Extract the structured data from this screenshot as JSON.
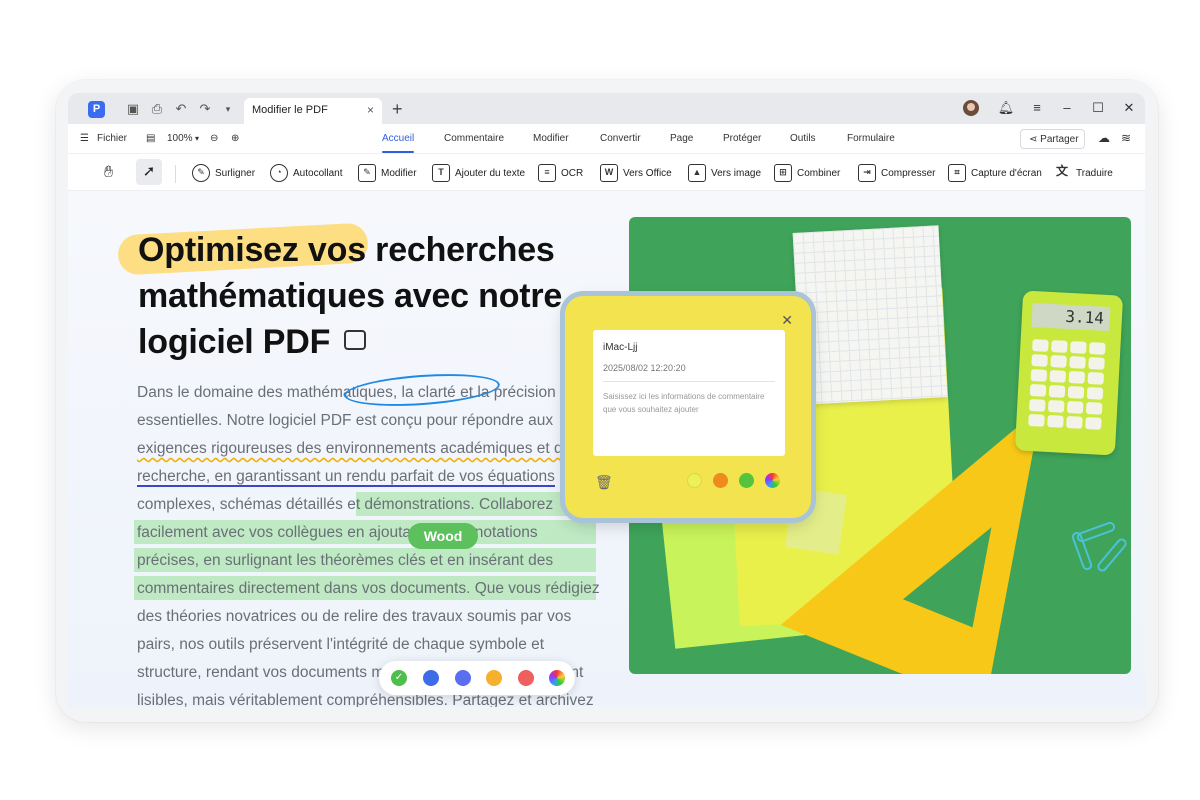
{
  "titlebar": {
    "tab_title": "Modifier le PDF",
    "tab_close_icon": "×",
    "new_tab_icon": "+"
  },
  "menubar": {
    "file_label": "Fichier",
    "zoom": "100%",
    "tabs": [
      "Accueil",
      "Commentaire",
      "Modifier",
      "Convertir",
      "Page",
      "Protéger",
      "Outils",
      "Formulaire"
    ],
    "active_tab": "Accueil",
    "share_label": "Partager"
  },
  "toolbar": {
    "tools": [
      "Surligner",
      "Autocollant",
      "Modifier",
      "Ajouter du texte",
      "OCR",
      "Vers Office",
      "Vers image",
      "Combiner",
      "Compresser",
      "Capture d'écran",
      "Traduire"
    ]
  },
  "document": {
    "headline_lines": [
      "Optimisez vos recherches",
      "mathématiques avec notre",
      "logiciel PDF"
    ],
    "body_lines": [
      "Dans le domaine des mathématiques, la clarté et la précision sont",
      "essentielles. Notre logiciel PDF est conçu pour répondre aux",
      "exigences rigoureuses des environnements académiques et de",
      "recherche, en garantissant un rendu parfait de vos équations",
      "complexes, schémas détaillés et démonstrations. Collaborez",
      "facilement avec vos collègues en ajoutant des annotations",
      "précises, en surlignant les théorèmes clés et en insérant des",
      "commentaires directement dans vos documents. Que vous rédigiez",
      "des théories novatrices ou de relire des travaux soumis par vos",
      "pairs, nos outils préservent l'intégrité de chaque symbole et",
      "structure, rendant vos documents mathématiques non seulement",
      "lisibles, mais véritablement compréhensibles. Partagez et archivez"
    ],
    "highlight_chip": "Wood"
  },
  "color_picker": {
    "colors": [
      "#4cbf4c",
      "#3d6ce8",
      "#5b6ef0",
      "#f5b02e",
      "#ef5f5f"
    ]
  },
  "comment": {
    "user": "iMac-Ljj",
    "timestamp": "2025/08/02 12:20:20",
    "placeholder": "Saisissez ici les informations de commentaire que vous souhaitez ajouter",
    "colors": [
      "#eef05a",
      "#ee8a1e",
      "#55c43a"
    ]
  },
  "photo": {
    "calculator_display": "3.14"
  }
}
